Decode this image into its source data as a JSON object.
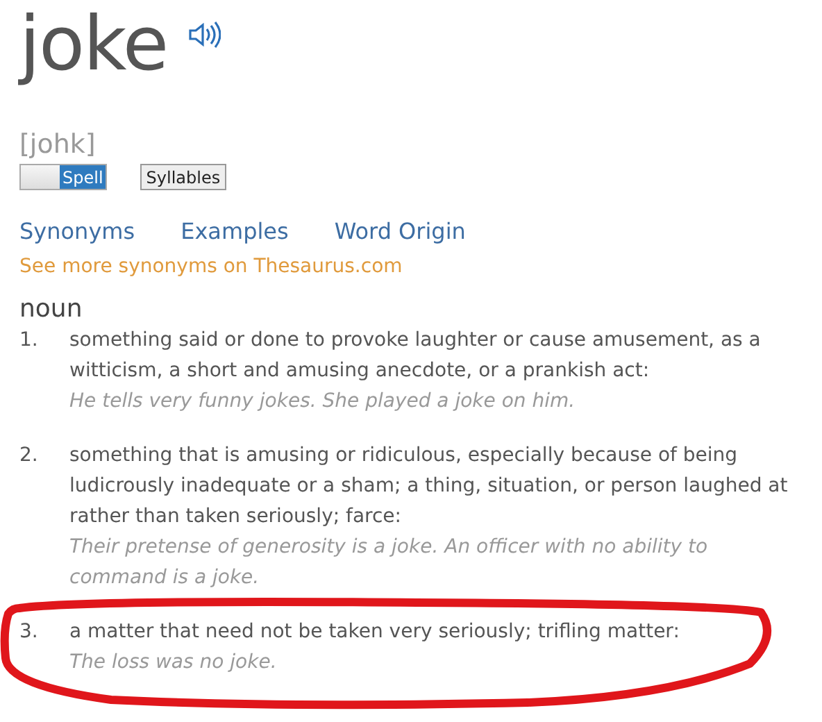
{
  "headword": "joke",
  "pronunciation": "[johk]",
  "spell_toggle": {
    "label": "Spell",
    "on": true
  },
  "syllables_button": "Syllables",
  "tabs": [
    {
      "label": "Synonyms"
    },
    {
      "label": "Examples"
    },
    {
      "label": "Word Origin"
    }
  ],
  "thesaurus_link": "See more synonyms on Thesaurus.com",
  "part_of_speech": "noun",
  "definitions": [
    {
      "number": "1.",
      "text": "something said or done to provoke laughter or cause amusement, as a witticism, a short and amusing anecdote, or a prankish act:",
      "example": "He tells very funny jokes. She played a joke on him."
    },
    {
      "number": "2.",
      "text": "something that is amusing or ridiculous, especially because of being ludicrously inadequate or a sham; a thing, situation, or person laughed at rather than taken seriously; farce:",
      "example": "Their pretense of generosity is a joke. An officer with no ability to command is a joke."
    },
    {
      "number": "3.",
      "text": "a matter that need not be taken very seriously; trifling matter:",
      "example": "The loss was no joke."
    }
  ],
  "annotation": {
    "kind": "loop",
    "color": "#e0161b"
  }
}
